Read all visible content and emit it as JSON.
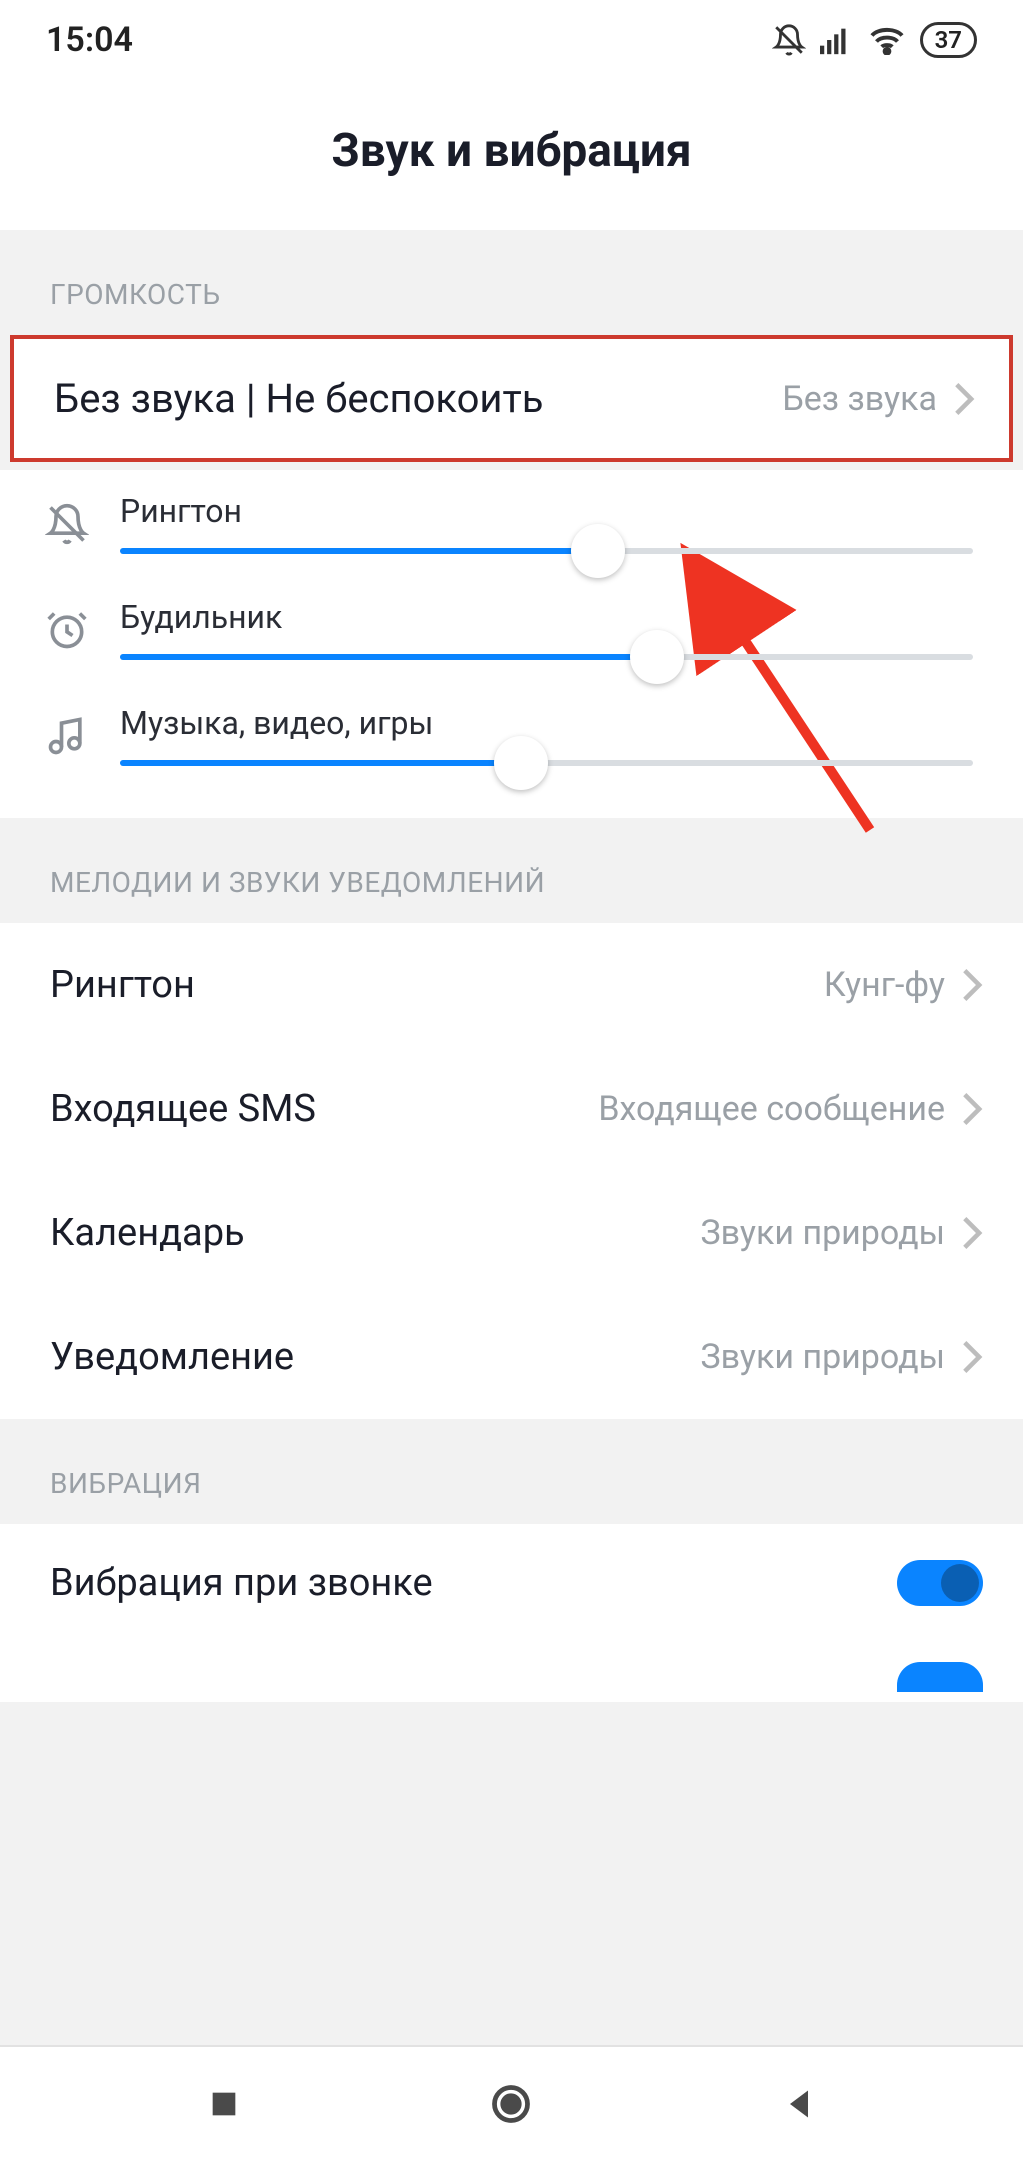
{
  "status": {
    "time": "15:04",
    "battery": "37"
  },
  "header": {
    "title": "Звук и вибрация"
  },
  "sections": {
    "volume_label": "ГРОМКОСТЬ",
    "melodies_label": "МЕЛОДИИ И ЗВУКИ УВЕДОМЛЕНИЙ",
    "vibration_label": "ВИБРАЦИЯ"
  },
  "silent": {
    "label": "Без звука | Не беспокоить",
    "value": "Без звука"
  },
  "sliders": {
    "ringtone": {
      "label": "Рингтон",
      "percent": 56
    },
    "alarm": {
      "label": "Будильник",
      "percent": 63
    },
    "media": {
      "label": "Музыка, видео, игры",
      "percent": 47
    }
  },
  "melodies": {
    "ringtone": {
      "label": "Рингтон",
      "value": "Кунг-фу"
    },
    "sms": {
      "label": "Входящее SMS",
      "value": "Входящее сообщение"
    },
    "calendar": {
      "label": "Календарь",
      "value": "Звуки природы"
    },
    "notification": {
      "label": "Уведомление",
      "value": "Звуки природы"
    }
  },
  "vibration": {
    "on_call": {
      "label": "Вибрация при звонке",
      "enabled": true
    }
  }
}
